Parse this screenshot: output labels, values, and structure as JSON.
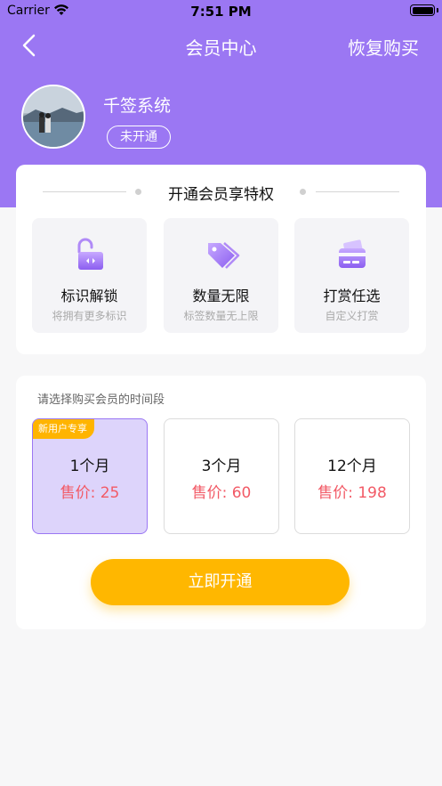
{
  "status_bar": {
    "carrier": "Carrier",
    "time": "7:51 PM"
  },
  "nav": {
    "title": "会员中心",
    "restore_label": "恢复购买"
  },
  "profile": {
    "username": "千签系统",
    "vip_status": "未开通"
  },
  "privileges": {
    "title": "开通会员享特权",
    "items": [
      {
        "icon": "unlock-icon",
        "title": "标识解锁",
        "desc": "将拥有更多标识"
      },
      {
        "icon": "tag-icon",
        "title": "数量无限",
        "desc": "标签数量无上限"
      },
      {
        "icon": "card-icon",
        "title": "打赏任选",
        "desc": "自定义打赏"
      }
    ]
  },
  "plans": {
    "hint": "请选择购买会员的时间段",
    "new_user_tag": "新用户专享",
    "selected_index": 0,
    "items": [
      {
        "name": "1个月",
        "price": "售价: 25"
      },
      {
        "name": "3个月",
        "price": "售价: 60"
      },
      {
        "name": "12个月",
        "price": "售价: 198"
      }
    ]
  },
  "buy_button": {
    "label": "立即开通"
  },
  "colors": {
    "header": "#9b77f3",
    "accent": "#ffb700",
    "price": "#f25a66",
    "selected_bg": "#ddd4fb"
  }
}
